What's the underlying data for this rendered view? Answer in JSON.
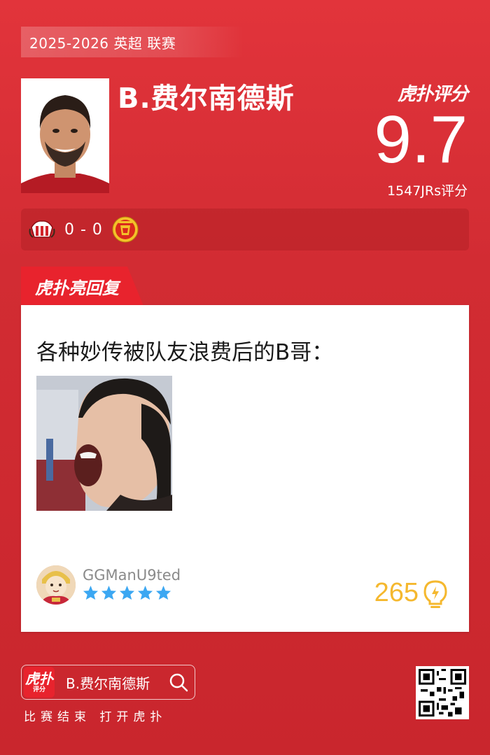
{
  "header": {
    "season": "2025-2026 英超 联赛",
    "player_name": "B.费尔南德斯",
    "brand": "虎扑评分",
    "score": "9.7",
    "votes": "1547JRs评分"
  },
  "match": {
    "score": "0 - 0",
    "home_badge": "sunderland-badge-icon",
    "away_badge": "manchester-united-badge-icon"
  },
  "hot_reply": {
    "tag": "虎扑亮回复",
    "text": "各种妙传被队友浪费后的B哥：",
    "username": "GGManU9ted",
    "stars": 5,
    "likes": "265",
    "like_icon": "lightbulb-icon",
    "star_color": "#3ba7f2",
    "like_color": "#f5b82e"
  },
  "footer": {
    "logo_big": "虎扑",
    "logo_small": "评分",
    "search_name": "B.费尔南德斯",
    "cta": "比赛结束 打开虎扑"
  },
  "colors": {
    "background": "#d22c33",
    "accent": "#e8232d"
  }
}
